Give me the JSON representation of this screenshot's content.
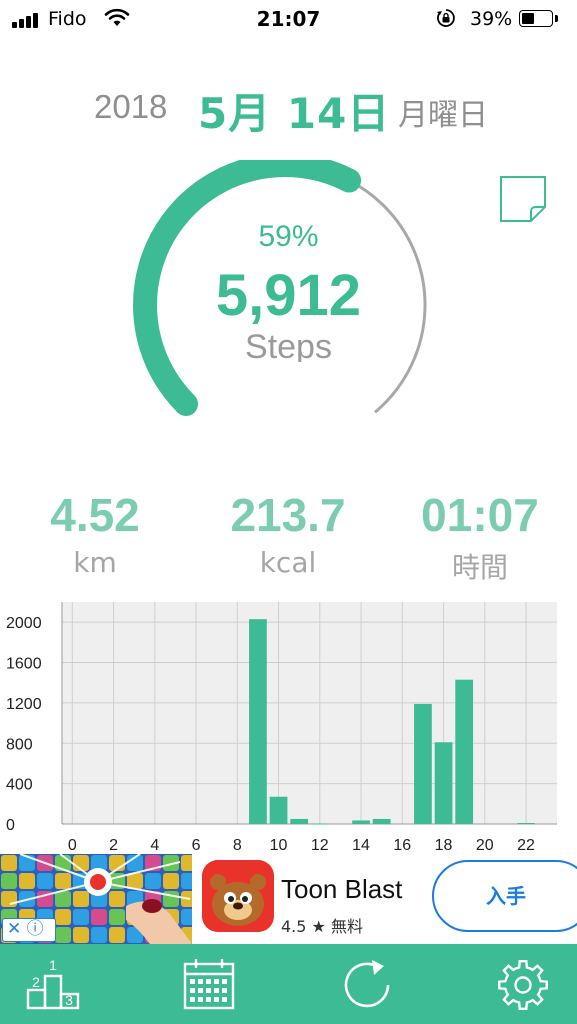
{
  "status_bar": {
    "carrier": "Fido",
    "time": "21:07",
    "battery_percent": "39%",
    "battery_level": 0.39,
    "icons": [
      "signal-icon",
      "wifi-icon",
      "rotation-lock-icon",
      "battery-icon"
    ]
  },
  "date": {
    "year": "2018",
    "month_day": "5月 14日",
    "weekday": "月曜日"
  },
  "progress": {
    "percent_label": "59%",
    "fraction": 0.59,
    "steps": "5,912",
    "steps_label": "Steps"
  },
  "stats": [
    {
      "value": "4.52",
      "unit": "km"
    },
    {
      "value": "213.7",
      "unit": "kcal"
    },
    {
      "value": "01:07",
      "unit": "時間"
    }
  ],
  "chart_data": {
    "type": "bar",
    "x": [
      0,
      1,
      2,
      3,
      4,
      5,
      6,
      7,
      8,
      9,
      10,
      11,
      12,
      13,
      14,
      15,
      16,
      17,
      18,
      19,
      20,
      21,
      22,
      23
    ],
    "values": [
      0,
      0,
      0,
      0,
      0,
      0,
      0,
      0,
      0,
      2030,
      270,
      50,
      5,
      0,
      35,
      50,
      0,
      1190,
      810,
      1430,
      0,
      0,
      10,
      0
    ],
    "x_tick_labels": [
      "0",
      "2",
      "4",
      "6",
      "8",
      "10",
      "12",
      "14",
      "16",
      "18",
      "20",
      "22"
    ],
    "y_tick_labels": [
      "0",
      "400",
      "800",
      "1200",
      "1600",
      "2000"
    ],
    "ylim": [
      0,
      2200
    ],
    "grid": true
  },
  "ad": {
    "title": "Toon Blast",
    "rating": "4.5 ★ 無料",
    "cta": "入手",
    "close_label": "✕ ⓘ"
  },
  "tabs": [
    "ranking-icon",
    "calendar-icon",
    "refresh-icon",
    "settings-icon"
  ],
  "colors": {
    "accent": "#3dbb95",
    "accent_light": "#7ccdb0",
    "gray_text": "#8f8f8f",
    "ring_track": "#a8a8a8",
    "ad_blue": "#1a7ce0"
  }
}
